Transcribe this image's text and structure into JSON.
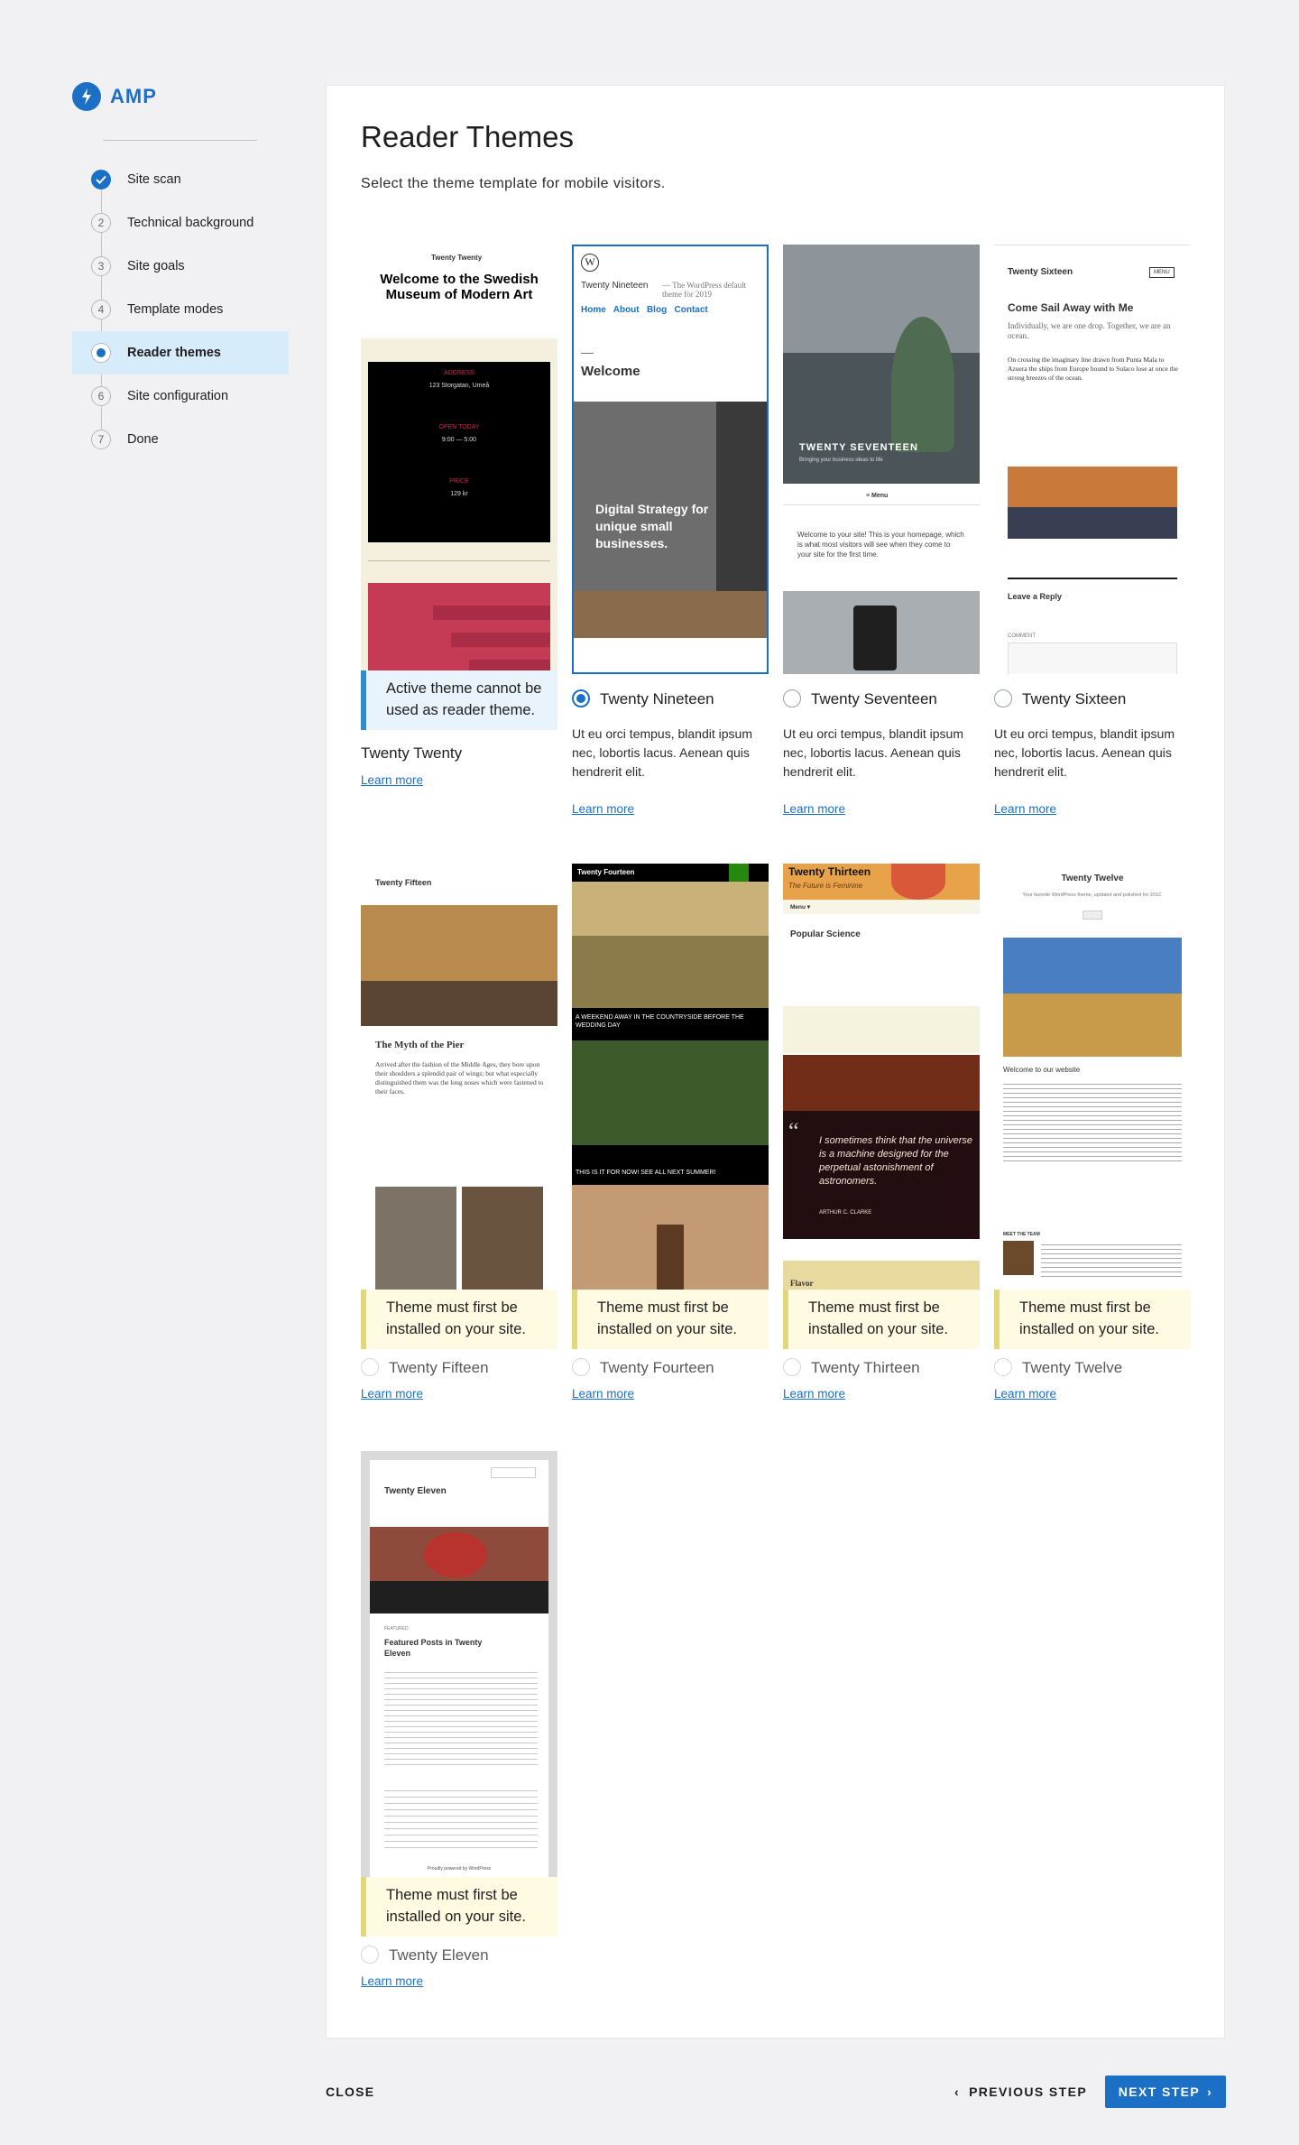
{
  "brand": {
    "name": "AMP"
  },
  "steps": [
    {
      "num": "",
      "label": "Site scan",
      "state": "done"
    },
    {
      "num": "2",
      "label": "Technical background",
      "state": "todo"
    },
    {
      "num": "3",
      "label": "Site goals",
      "state": "todo"
    },
    {
      "num": "4",
      "label": "Template modes",
      "state": "todo"
    },
    {
      "num": "",
      "label": "Reader themes",
      "state": "current"
    },
    {
      "num": "6",
      "label": "Site configuration",
      "state": "todo"
    },
    {
      "num": "7",
      "label": "Done",
      "state": "todo"
    }
  ],
  "page": {
    "title": "Reader Themes",
    "subtitle": "Select the theme template for mobile visitors."
  },
  "themes": {
    "twentytwenty": {
      "name": "Twenty Twenty",
      "notice": "Active theme cannot be used as reader theme.",
      "learn": "Learn more",
      "art": {
        "site": "Twenty Twenty",
        "headline": "Welcome to the Swedish Museum of Modern Art",
        "address": "ADDRESS",
        "addr_val": "123 Storgatan, Umeå",
        "open": "OPEN TODAY",
        "open_val": "9:00 — 5:00",
        "price": "PRICE",
        "price_val": "129 kr"
      }
    },
    "twentynineteen": {
      "name": "Twenty Nineteen",
      "desc": "Ut eu orci tempus, blandit ipsum nec, lobortis lacus. Aenean quis hendrerit elit.",
      "learn": "Learn more",
      "art": {
        "site": "Twenty Nineteen",
        "tagline": "— The WordPress default theme for 2019",
        "nav": "Home   About   Blog   Contact",
        "welcome": "Welcome",
        "hero": "Digital Strategy for unique small businesses."
      }
    },
    "twentyseventeen": {
      "name": "Twenty Seventeen",
      "desc": "Ut eu orci tempus, blandit ipsum nec, lobortis lacus. Aenean quis hendrerit elit.",
      "learn": "Learn more",
      "art": {
        "site": "TWENTY SEVENTEEN",
        "tagline": "Bringing your business ideas to life",
        "menu": "≡ Menu",
        "text": "Welcome to your site! This is your homepage, which is what most visitors will see when they come to your site for the first time."
      }
    },
    "twentysixteen": {
      "name": "Twenty Sixteen",
      "desc": "Ut eu orci tempus, blandit ipsum nec, lobortis lacus. Aenean quis hendrerit elit.",
      "learn": "Learn more",
      "art": {
        "site": "Twenty Sixteen",
        "menu": "MENU",
        "post_title": "Come Sail Away with Me",
        "lead": "Individually, we are one drop. Together, we are an ocean.",
        "body": "On crossing the imaginary line drawn from Punta Mala to Azuera the ships from Europe bound to Sulaco lose at once the strong breezes of the ocean.",
        "reply": "Leave a Reply",
        "comment": "COMMENT"
      }
    },
    "twentyfifteen": {
      "name": "Twenty Fifteen",
      "notice": "Theme must first be installed on your site.",
      "learn": "Learn more",
      "art": {
        "site": "Twenty Fifteen",
        "post_title": "The Myth of the Pier",
        "body": "Arrived after the fashion of the Middle Ages, they bore upon their shoulders a splendid pair of wings; but what especially distinguished them was the long noses which were fastened to their faces."
      }
    },
    "twentyfourteen": {
      "name": "Twenty Fourteen",
      "notice": "Theme must first be installed on your site.",
      "learn": "Learn more",
      "art": {
        "site": "Twenty Fourteen",
        "cap1": "A WEEKEND AWAY IN THE COUNTRYSIDE BEFORE THE WEDDING DAY",
        "cap2": "THIS IS IT FOR NOW! SEE ALL NEXT SUMMER!"
      }
    },
    "twentythirteen": {
      "name": "Twenty Thirteen",
      "notice": "Theme must first be installed on your site.",
      "learn": "Learn more",
      "art": {
        "site": "Twenty Thirteen",
        "tagline": "The Future is Feminine",
        "menu": "Menu ▾",
        "post_title": "Popular Science",
        "quote": "I sometimes think that the universe is a machine designed for the perpetual astonishment of astronomers.",
        "author": "ARTHUR C. CLARKE",
        "flavor": "Flavor"
      }
    },
    "twentytwelve": {
      "name": "Twenty Twelve",
      "notice": "Theme must first be installed on your site.",
      "learn": "Learn more",
      "art": {
        "site": "Twenty Twelve",
        "tagline": "Your favorite WordPress theme, updated and polished for 2012.",
        "welcome": "Welcome to our website",
        "meet": "MEET THE TEAM"
      }
    },
    "twentyeleven": {
      "name": "Twenty Eleven",
      "notice": "Theme must first be installed on your site.",
      "learn": "Learn more",
      "art": {
        "site": "Twenty Eleven",
        "featured": "FEATURED",
        "post_title": "Featured Posts in Twenty Eleven",
        "footer": "Proudly powered by WordPress"
      }
    }
  },
  "footer": {
    "close": "CLOSE",
    "prev": "PREVIOUS STEP",
    "next": "NEXT STEP"
  },
  "colors": {
    "accent": "#1b70c6",
    "active_bg": "#d7ecfb"
  }
}
